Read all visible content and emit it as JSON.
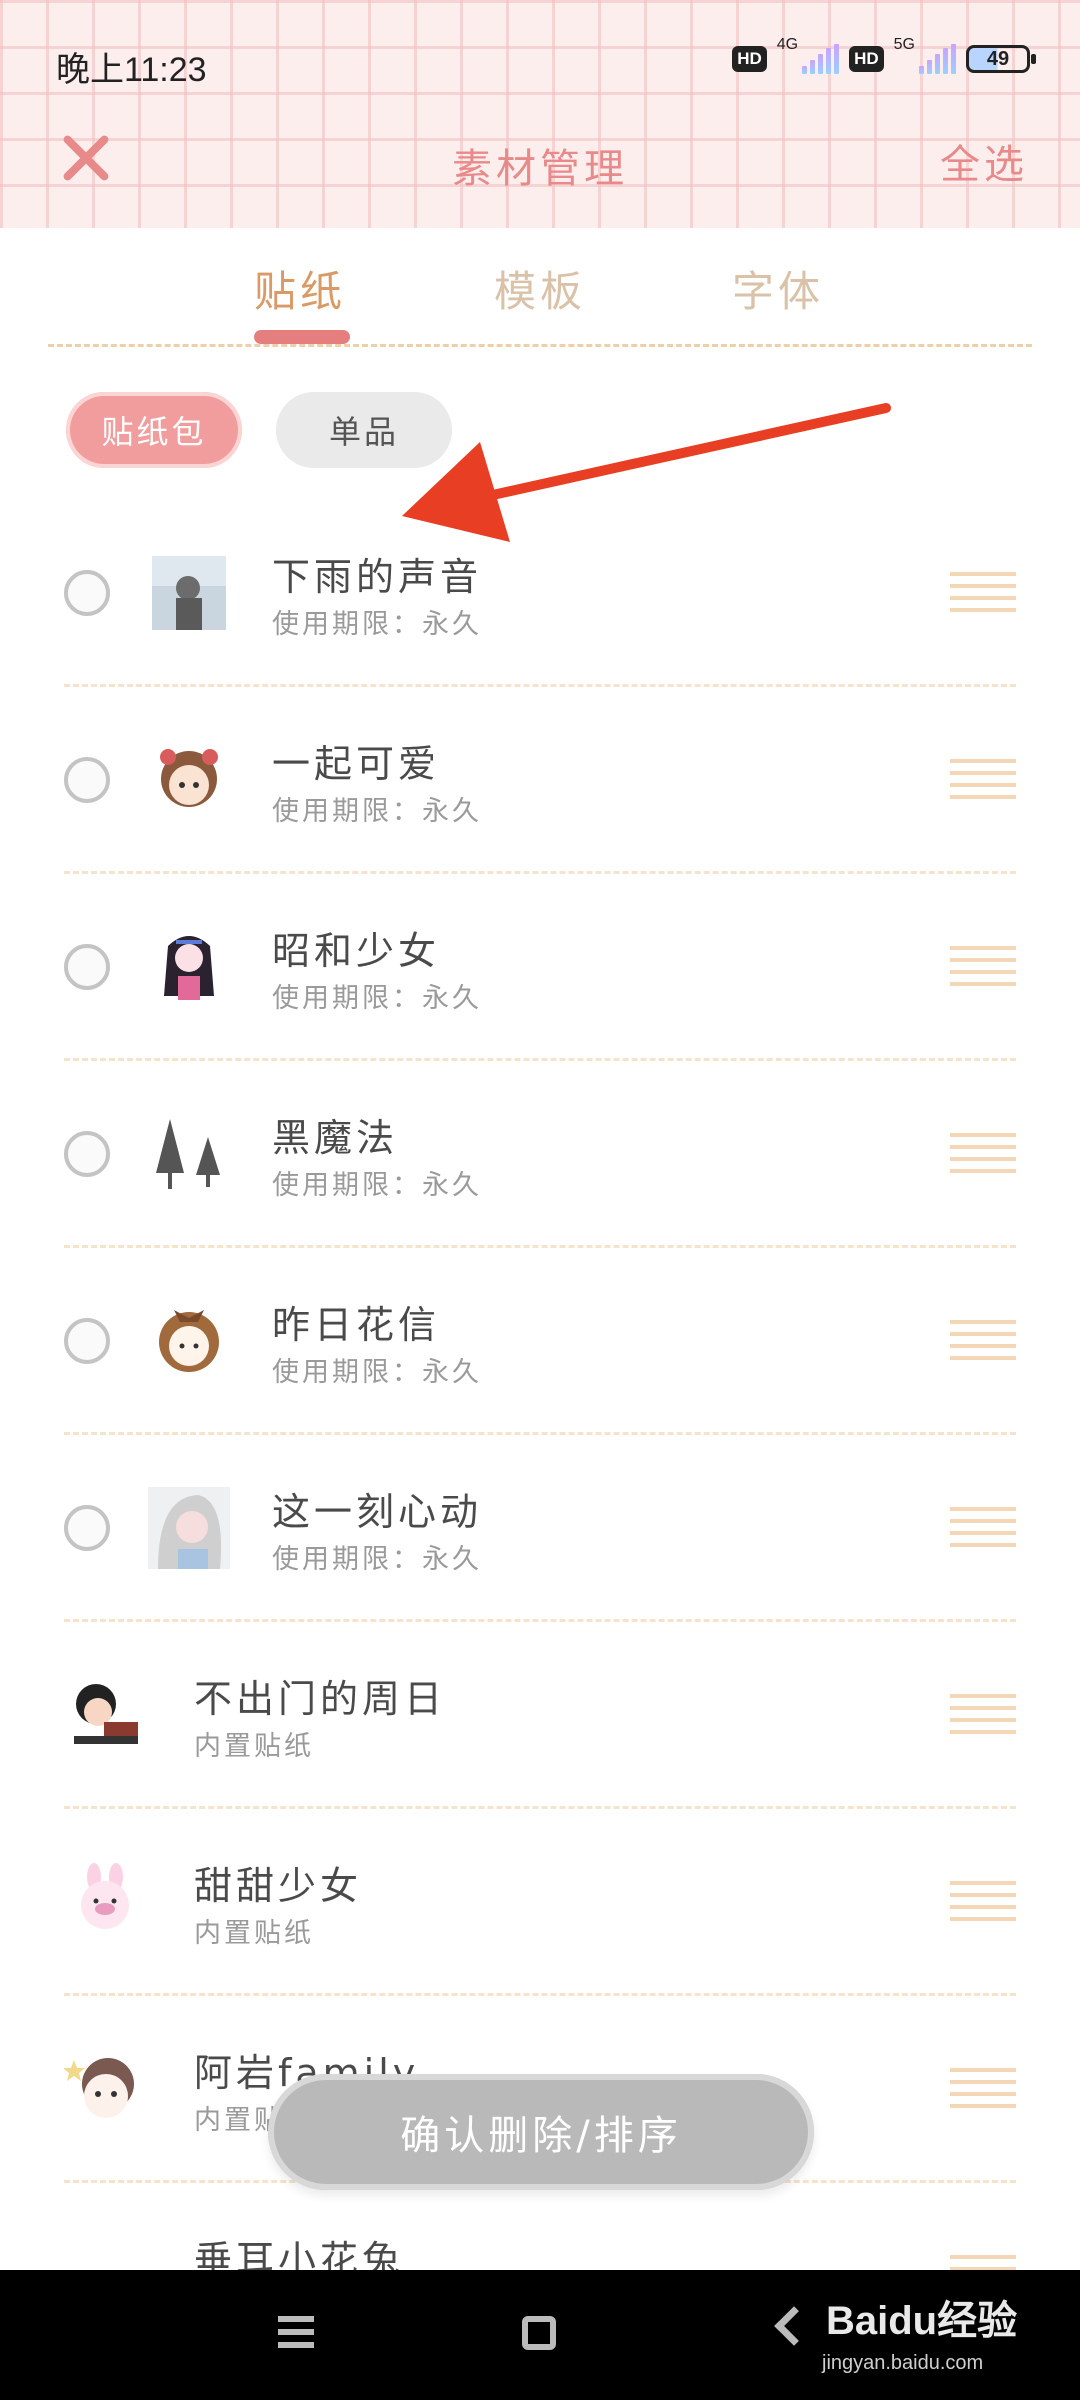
{
  "status_bar": {
    "time": "晚上11:23",
    "hd1": "HD",
    "net1": "4G",
    "hd2": "HD",
    "net2": "5G",
    "battery": "49"
  },
  "nav": {
    "close_icon": "close-icon",
    "title": "素材管理",
    "select_all": "全选"
  },
  "tabs": [
    {
      "label": "贴纸",
      "active": true
    },
    {
      "label": "模板",
      "active": false
    },
    {
      "label": "字体",
      "active": false
    }
  ],
  "filters": {
    "pack": "贴纸包",
    "single": "单品"
  },
  "items": [
    {
      "title": "下雨的声音",
      "sub": "使用期限：永久",
      "selectable": true
    },
    {
      "title": "一起可爱",
      "sub": "使用期限：永久",
      "selectable": true
    },
    {
      "title": "昭和少女",
      "sub": "使用期限：永久",
      "selectable": true
    },
    {
      "title": "黑魔法",
      "sub": "使用期限：永久",
      "selectable": true
    },
    {
      "title": "昨日花信",
      "sub": "使用期限：永久",
      "selectable": true
    },
    {
      "title": "这一刻心动",
      "sub": "使用期限：永久",
      "selectable": true
    },
    {
      "title": "不出门的周日",
      "sub": "内置贴纸",
      "selectable": false
    },
    {
      "title": "甜甜少女",
      "sub": "内置贴纸",
      "selectable": false
    },
    {
      "title": "阿岩family",
      "sub": "内置贴纸",
      "selectable": false
    },
    {
      "title": "垂耳小花兔",
      "sub": "",
      "selectable": false
    }
  ],
  "confirm_button": "确认删除/排序",
  "watermark": "Baidu经验",
  "watermark_sub": "jingyan.baidu.com",
  "colors": {
    "accent": "#e88a8a",
    "tab_active": "#d99a66",
    "chip_active": "#f19d9d"
  }
}
